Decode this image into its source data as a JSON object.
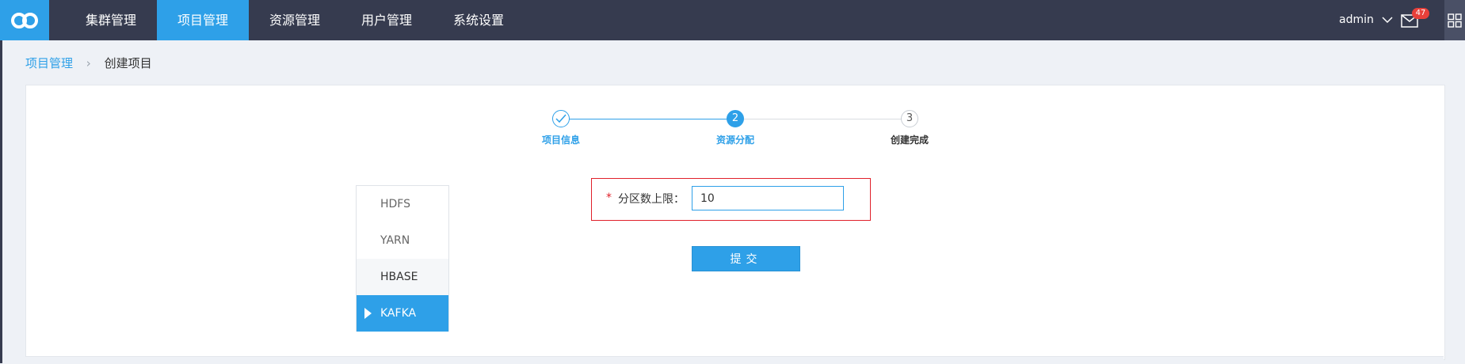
{
  "nav": {
    "items": [
      {
        "label": "集群管理"
      },
      {
        "label": "项目管理"
      },
      {
        "label": "资源管理"
      },
      {
        "label": "用户管理"
      },
      {
        "label": "系统设置"
      }
    ],
    "active_index": 1,
    "user": "admin",
    "notification_count": "47",
    "accent_color": "#2ea0e8",
    "bar_color": "#363b4f"
  },
  "breadcrumb": {
    "parent": "项目管理",
    "current": "创建项目"
  },
  "steps": [
    {
      "number": "1",
      "label": "项目信息",
      "status": "done"
    },
    {
      "number": "2",
      "label": "资源分配",
      "status": "active"
    },
    {
      "number": "3",
      "label": "创建完成",
      "status": "pending"
    }
  ],
  "side_menu": {
    "items": [
      {
        "label": "HDFS"
      },
      {
        "label": "YARN"
      },
      {
        "label": "HBASE"
      },
      {
        "label": "KAFKA"
      }
    ],
    "active": "KAFKA"
  },
  "form": {
    "required_mark": "*",
    "label": "分区数上限：",
    "value": "10",
    "submit_label": "提交"
  }
}
